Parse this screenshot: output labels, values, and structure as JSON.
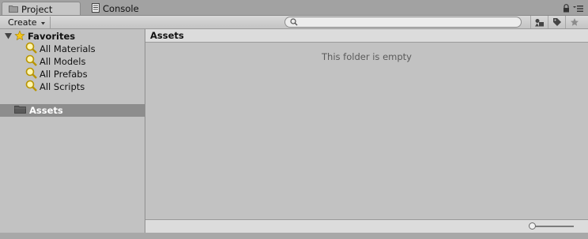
{
  "tabs": [
    {
      "label": "Project",
      "icon": "folder-icon",
      "active": true
    },
    {
      "label": "Console",
      "icon": "console-icon",
      "active": false
    }
  ],
  "tab_icons": [
    "lock-icon",
    "menu-icon"
  ],
  "toolbar": {
    "create_label": "Create",
    "search_placeholder": "",
    "buttons": [
      "filter-by-type-icon",
      "filter-by-label-icon",
      "favorite-star-icon"
    ]
  },
  "sidebar": {
    "favorites_label": "Favorites",
    "favorites": [
      {
        "label": "All Materials"
      },
      {
        "label": "All Models"
      },
      {
        "label": "All Prefabs"
      },
      {
        "label": "All Scripts"
      }
    ],
    "assets_label": "Assets"
  },
  "main": {
    "breadcrumb": "Assets",
    "empty_message": "This folder is empty",
    "zoom_level": 0
  },
  "colors": {
    "selection": "#8d8d8d",
    "panel": "#c2c2c2",
    "header": "#dcdcdc",
    "star": "#f5c518"
  }
}
